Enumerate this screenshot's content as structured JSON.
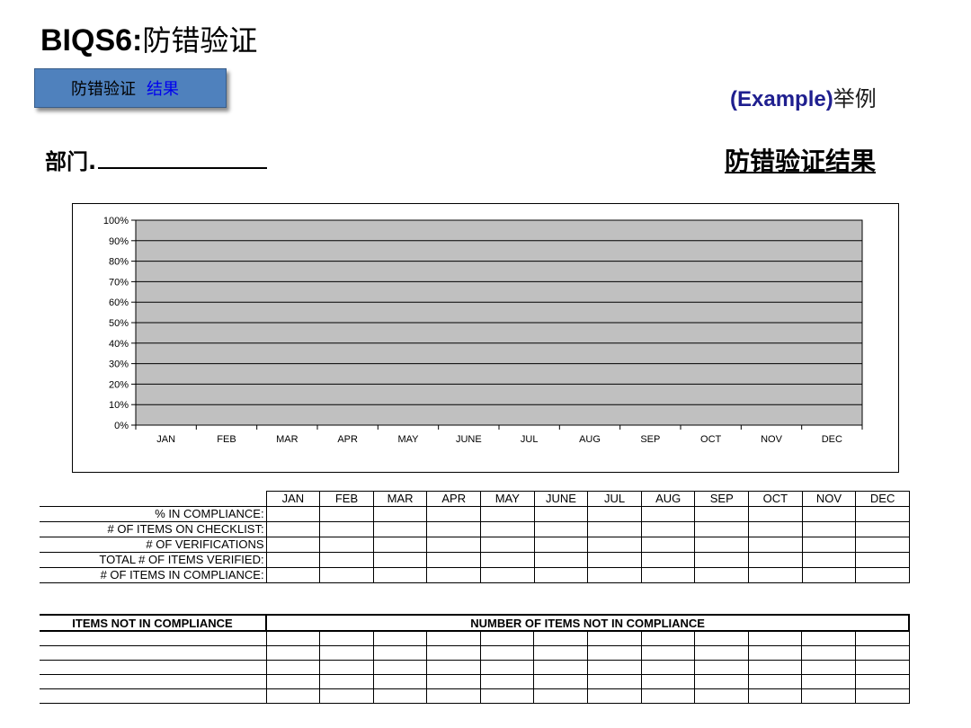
{
  "title": {
    "code": "BIQS6:",
    "text": "防错验证"
  },
  "tag": {
    "part1": "防错验证",
    "part2": "结果"
  },
  "example": {
    "en": "(Example)",
    "cn": "举例"
  },
  "department": {
    "label": "部门."
  },
  "result_title": "防错验证结果",
  "chart_data": {
    "type": "bar",
    "categories": [
      "JAN",
      "FEB",
      "MAR",
      "APR",
      "MAY",
      "JUNE",
      "JUL",
      "AUG",
      "SEP",
      "OCT",
      "NOV",
      "DEC"
    ],
    "series": [],
    "y_ticks": [
      "0%",
      "10%",
      "20%",
      "30%",
      "40%",
      "50%",
      "60%",
      "70%",
      "80%",
      "90%",
      "100%"
    ],
    "ylim": [
      0,
      100
    ],
    "grid": true,
    "plot_background": "#c0c0c0"
  },
  "compliance_table": {
    "months": [
      "JAN",
      "FEB",
      "MAR",
      "APR",
      "MAY",
      "JUNE",
      "JUL",
      "AUG",
      "SEP",
      "OCT",
      "NOV",
      "DEC"
    ],
    "rows": [
      "% IN COMPLIANCE:",
      "# OF ITEMS ON CHECKLIST:",
      "# OF VERIFICATIONS",
      "TOTAL # OF ITEMS VERIFIED:",
      "# OF ITEMS IN COMPLIANCE:"
    ]
  },
  "noncompliance_table": {
    "col1_header": "ITEMS NOT IN COMPLIANCE",
    "col2_header": "NUMBER OF ITEMS NOT IN COMPLIANCE",
    "empty_rows": 5
  },
  "colors": {
    "tag_fill": "#4f81bd",
    "tag_highlight": "#0000ee",
    "example_text": "#1f1f8f",
    "plot_fill": "#c0c0c0"
  }
}
